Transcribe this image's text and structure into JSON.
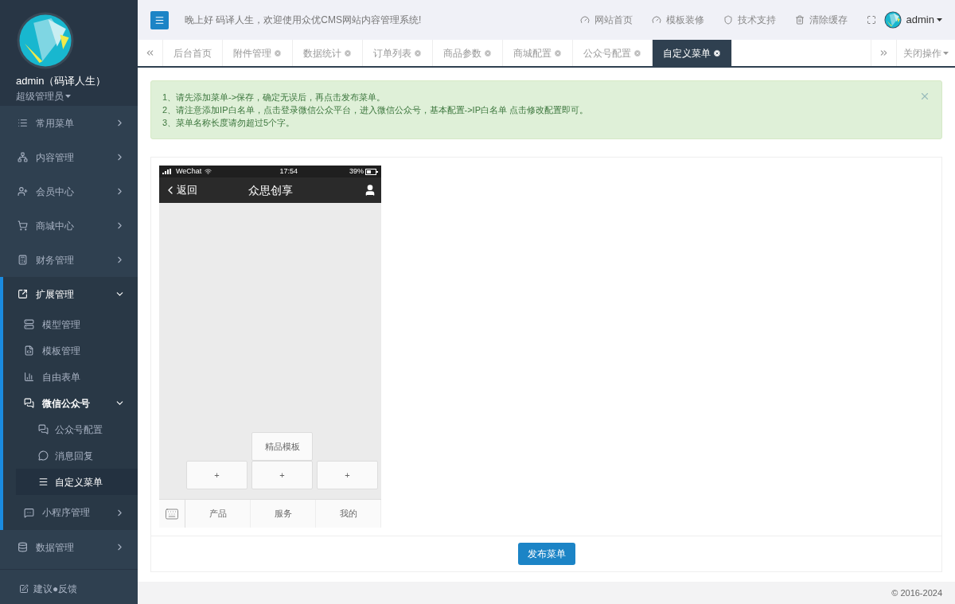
{
  "profile": {
    "name": "admin（码译人生）",
    "role": "超级管理员"
  },
  "sidebar": {
    "items": [
      {
        "label": "常用菜单",
        "expanded": false
      },
      {
        "label": "内容管理",
        "expanded": false
      },
      {
        "label": "会员中心",
        "expanded": false
      },
      {
        "label": "商城中心",
        "expanded": false
      },
      {
        "label": "财务管理",
        "expanded": false
      },
      {
        "label": "扩展管理",
        "expanded": true,
        "children": [
          {
            "label": "模型管理",
            "selected": false
          },
          {
            "label": "模板管理",
            "selected": false
          },
          {
            "label": "自由表单",
            "selected": false
          },
          {
            "label": "微信公众号",
            "expanded": true,
            "children": [
              {
                "label": "公众号配置",
                "selected": false
              },
              {
                "label": "消息回复",
                "selected": false
              },
              {
                "label": "自定义菜单",
                "selected": true
              }
            ]
          },
          {
            "label": "小程序管理",
            "expanded": false
          }
        ]
      },
      {
        "label": "数据管理",
        "expanded": false
      }
    ],
    "feedback": "建议●反馈"
  },
  "header": {
    "welcome": "晚上好 码译人生，欢迎使用众优CMS网站内容管理系统!",
    "links": [
      "网站首页",
      "模板装修",
      "技术支持",
      "清除缓存"
    ],
    "user": "admin"
  },
  "tabs": [
    {
      "label": "后台首页",
      "closable": false,
      "selected": false
    },
    {
      "label": "附件管理",
      "closable": true,
      "selected": false
    },
    {
      "label": "数据统计",
      "closable": true,
      "selected": false
    },
    {
      "label": "订单列表",
      "closable": true,
      "selected": false
    },
    {
      "label": "商品参数",
      "closable": true,
      "selected": false
    },
    {
      "label": "商城配置",
      "closable": true,
      "selected": false
    },
    {
      "label": "公众号配置",
      "closable": true,
      "selected": false
    },
    {
      "label": "自定义菜单",
      "closable": true,
      "selected": true
    }
  ],
  "close_actions": "关闭操作",
  "alert": [
    "1、请先添加菜单->保存，确定无误后，再点击发布菜单。",
    "2、请注意添加IP白名单，点击登录微信公众平台，进入微信公众号，基本配置->IP白名单 点击修改配置即可。",
    "3、菜单名称长度请勿超过5个字。"
  ],
  "phone": {
    "carrier": "WeChat",
    "time": "17:54",
    "battery": "39%",
    "back": "返回",
    "title": "众思创享",
    "menu": [
      {
        "label": "产品",
        "sub": [
          "+"
        ]
      },
      {
        "label": "服务",
        "sub": [
          "精品模板",
          "+"
        ]
      },
      {
        "label": "我的",
        "sub": [
          "+"
        ]
      }
    ]
  },
  "publish_button": "发布菜单",
  "footer": "© 2016-2024"
}
